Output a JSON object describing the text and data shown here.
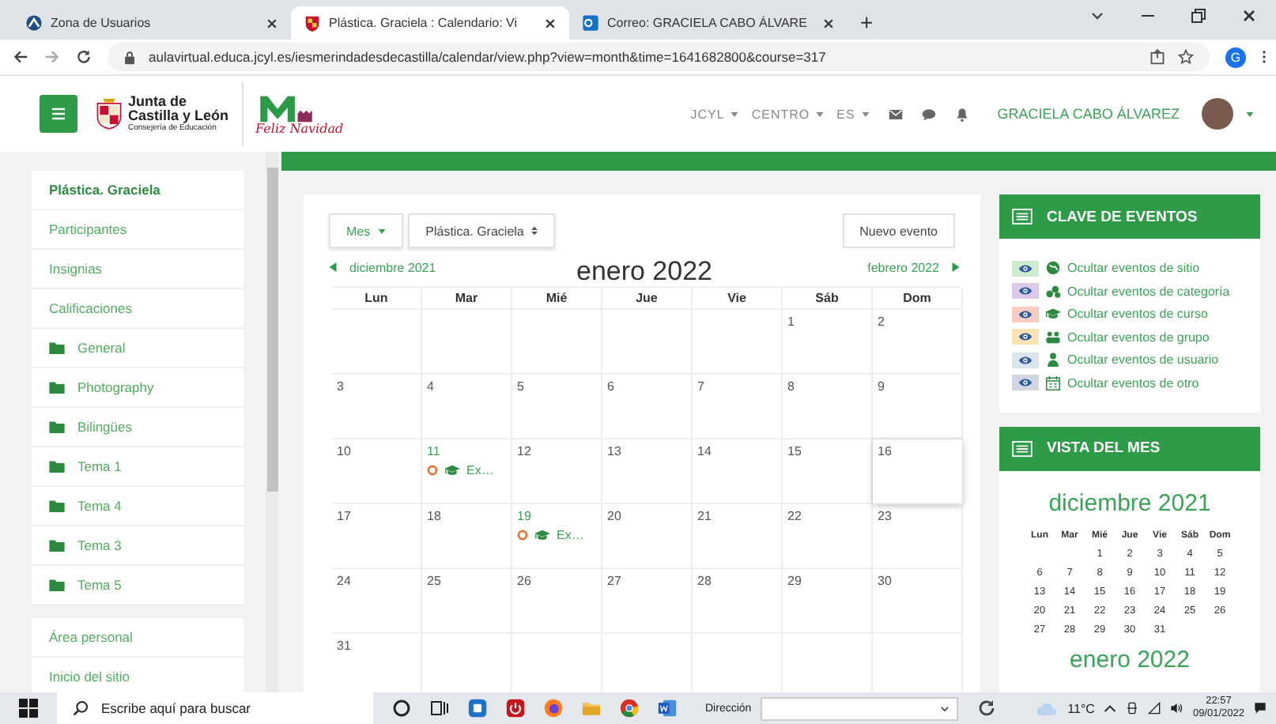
{
  "browser": {
    "tabs": [
      {
        "title": "Zona de Usuarios",
        "kind": "site",
        "selected": false
      },
      {
        "title": "Plástica. Graciela : Calendario: Vi",
        "kind": "course",
        "selected": true
      },
      {
        "title": "Correo: GRACIELA CABO ÁLVARE",
        "kind": "mail",
        "selected": false
      }
    ],
    "new_tab": "+",
    "url": "aulavirtual.educa.jcyl.es/iesmerindadesdecastilla/calendar/view.php?view=month&time=1641682800&course=317",
    "profile_initial": "G"
  },
  "header": {
    "logo_lines": [
      "Junta de",
      "Castilla y León"
    ],
    "logo_subtitle": "Consejería de Educación",
    "greeting": "Feliz Navidad",
    "menus": [
      "JCYL",
      "CENTRO",
      "ES"
    ],
    "user_name": "GRACIELA CABO ÁLVAREZ"
  },
  "sidebar": {
    "course_items": [
      {
        "label": "Plástica. Graciela",
        "kind": "course",
        "selected": true
      },
      {
        "label": "Participantes",
        "kind": "link",
        "selected": false
      },
      {
        "label": "Insignias",
        "kind": "link",
        "selected": false
      },
      {
        "label": "Calificaciones",
        "kind": "link",
        "selected": false
      },
      {
        "label": "General",
        "kind": "section",
        "selected": false
      },
      {
        "label": "Photography",
        "kind": "section",
        "selected": false
      },
      {
        "label": "Bilingües",
        "kind": "section",
        "selected": false
      },
      {
        "label": "Tema 1",
        "kind": "section",
        "selected": false
      },
      {
        "label": "Tema 4",
        "kind": "section",
        "selected": false
      },
      {
        "label": "Tema 3",
        "kind": "section",
        "selected": false
      },
      {
        "label": "Tema 5",
        "kind": "section",
        "selected": false
      }
    ],
    "site_items": [
      {
        "label": "Área personal"
      },
      {
        "label": "Inicio del sitio"
      }
    ]
  },
  "calendar": {
    "view_button": "Mes",
    "course_select": "Plástica. Graciela",
    "new_event_button": "Nuevo evento",
    "prev_month": "diciembre 2021",
    "title": "enero 2022",
    "next_month": "febrero 2022",
    "weekdays": [
      "Lun",
      "Mar",
      "Mié",
      "Jue",
      "Vie",
      "Sáb",
      "Dom"
    ],
    "weeks": [
      [
        {
          "day": "1",
          "highlighted": false
        },
        {
          "day": "2",
          "highlighted": false
        }
      ],
      [
        {
          "day": "3",
          "highlighted": false
        },
        {
          "day": "4",
          "highlighted": false
        },
        {
          "day": "5",
          "highlighted": false
        },
        {
          "day": "6",
          "highlighted": false
        },
        {
          "day": "7",
          "highlighted": false
        },
        {
          "day": "8",
          "highlighted": false
        },
        {
          "day": "9",
          "highlighted": false
        }
      ],
      [
        {
          "day": "10",
          "highlighted": false
        },
        {
          "day": "11",
          "highlighted": false,
          "events": [
            {
              "label": "Ex…"
            }
          ]
        },
        {
          "day": "12",
          "highlighted": false
        },
        {
          "day": "13",
          "highlighted": false
        },
        {
          "day": "14",
          "highlighted": false
        },
        {
          "day": "15",
          "highlighted": false
        },
        {
          "day": "16",
          "highlighted": true
        }
      ],
      [
        {
          "day": "17",
          "highlighted": false
        },
        {
          "day": "18",
          "highlighted": false
        },
        {
          "day": "19",
          "highlighted": false,
          "events": [
            {
              "label": "Ex…"
            }
          ]
        },
        {
          "day": "20",
          "highlighted": false
        },
        {
          "day": "21",
          "highlighted": false
        },
        {
          "day": "22",
          "highlighted": false
        },
        {
          "day": "23",
          "highlighted": false
        }
      ],
      [
        {
          "day": "24",
          "highlighted": false
        },
        {
          "day": "25",
          "highlighted": false
        },
        {
          "day": "26",
          "highlighted": false
        },
        {
          "day": "27",
          "highlighted": false
        },
        {
          "day": "28",
          "highlighted": false
        },
        {
          "day": "29",
          "highlighted": false
        },
        {
          "day": "30",
          "highlighted": false
        }
      ],
      [
        {
          "day": "31",
          "highlighted": false
        }
      ]
    ]
  },
  "legend": {
    "title": "CLAVE DE EVENTOS",
    "items": [
      {
        "label": "Ocultar eventos de sitio",
        "kind": "site",
        "color": "#cdeccd"
      },
      {
        "label": "Ocultar eventos de categoría",
        "kind": "category",
        "color": "#dcc8ea"
      },
      {
        "label": "Ocultar eventos de curso",
        "kind": "course",
        "color": "#f8cbc2"
      },
      {
        "label": "Ocultar eventos de grupo",
        "kind": "group",
        "color": "#fbe2b2"
      },
      {
        "label": "Ocultar eventos de usuario",
        "kind": "user",
        "color": "#dbe5ef"
      },
      {
        "label": "Ocultar eventos de otro",
        "kind": "other",
        "color": "#d2d6e0"
      }
    ]
  },
  "month_view": {
    "title": "VISTA DEL MES",
    "month": "diciembre 2021",
    "weekdays": [
      "Lun",
      "Mar",
      "Mié",
      "Jue",
      "Vie",
      "Sáb",
      "Dom"
    ],
    "weeks": [
      [
        "1",
        "2",
        "3",
        "4",
        "5"
      ],
      [
        "6",
        "7",
        "8",
        "9",
        "10",
        "11",
        "12"
      ],
      [
        "13",
        "14",
        "15",
        "16",
        "17",
        "18",
        "19"
      ],
      [
        "20",
        "21",
        "22",
        "23",
        "24",
        "25",
        "26"
      ],
      [
        "27",
        "28",
        "29",
        "30",
        "31"
      ]
    ],
    "next_month": "enero 2022"
  },
  "taskbar": {
    "search_placeholder": "Escribe aquí para buscar",
    "address_label": "Dirección",
    "weather": "11°C",
    "time": "22:57",
    "date": "09/01/2022"
  }
}
